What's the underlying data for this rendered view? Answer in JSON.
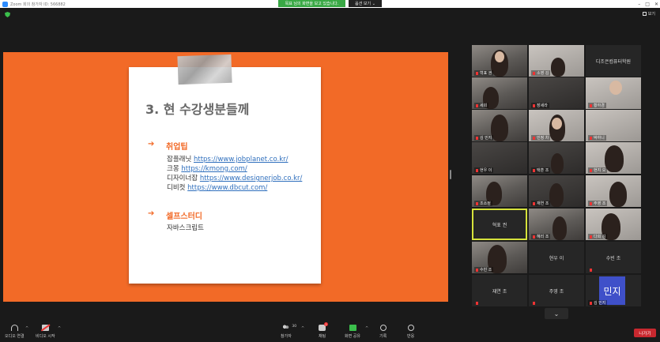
{
  "window": {
    "title": "Zoom 회의 참가자 ID: 566882",
    "controls": [
      "–",
      "□",
      "✕"
    ]
  },
  "banner": {
    "share_text": "목표 님의 화면을 보고 있습니다.",
    "view_options": "옵션 보기 ⌄"
  },
  "topbar": {
    "view_label": "보기"
  },
  "slide": {
    "title": "3. 현 수강생분들께",
    "section1": {
      "arrow": "➔",
      "heading": "취업팁",
      "lines": [
        {
          "label": "잡플래닛 ",
          "url": "https://www.jobplanet.co.kr/"
        },
        {
          "label": "크몽 ",
          "url": "https://kmong.com/"
        },
        {
          "label": "디자이너잡 ",
          "url": "https://www.designerjob.co.kr/"
        },
        {
          "label": "디비컷 ",
          "url": "https://www.dbcut.com/"
        }
      ]
    },
    "section2": {
      "arrow": "➔",
      "heading": "셀프스터디",
      "lines": [
        {
          "label": "자바스크립트"
        }
      ]
    }
  },
  "gallery": [
    {
      "name": "혁표 권"
    },
    {
      "name": "소영 김"
    },
    {
      "name": "디조은컴퓨터학원"
    },
    {
      "name": "세희"
    },
    {
      "name": "장세라"
    },
    {
      "name": "황하경"
    },
    {
      "name": "김 민지"
    },
    {
      "name": "민정 차"
    },
    {
      "name": "박하니"
    },
    {
      "name": "현우 이"
    },
    {
      "name": "택훈 조"
    },
    {
      "name": "현지 오"
    },
    {
      "name": "조소정"
    },
    {
      "name": "재연 조"
    },
    {
      "name": "주영 조"
    },
    {
      "name": "혁표 권"
    },
    {
      "name": "혜리 조"
    },
    {
      "name": "다희 김"
    },
    {
      "name": "수빈 조"
    },
    {
      "name": "현우 이"
    },
    {
      "name": "수빈 조"
    },
    {
      "name": "재연 조"
    },
    {
      "name": "주영 조"
    },
    {
      "name": "김 민지",
      "avatar": "민지"
    }
  ],
  "gallery_more": "⌄",
  "toolbar": {
    "audio": "오디오 연결",
    "video": "비디오 시작",
    "participants": "참가자",
    "participants_count": "30",
    "chat": "채팅",
    "chat_badge": "1",
    "share": "화면 공유",
    "record": "기록",
    "reactions": "반응",
    "leave": "나가기",
    "caret": "^"
  }
}
